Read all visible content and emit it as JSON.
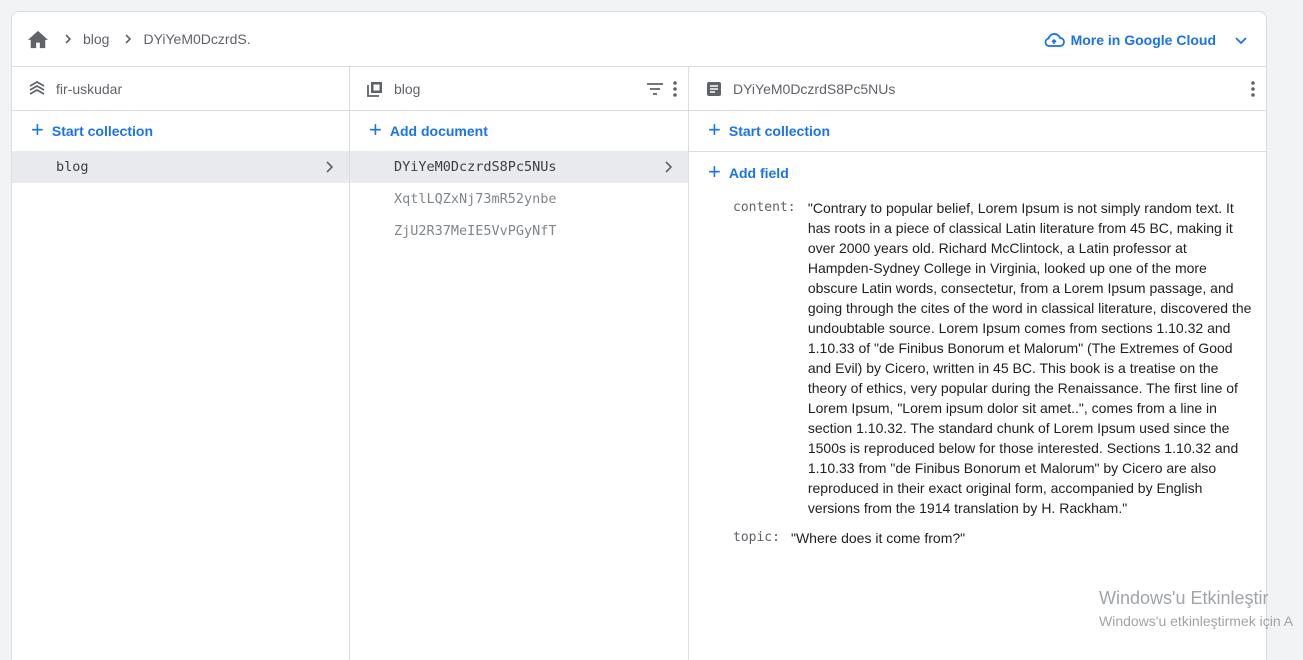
{
  "breadcrumb": {
    "items": [
      "blog",
      "DYiYeM0DczrdS."
    ]
  },
  "gcloud": {
    "label": "More in Google Cloud"
  },
  "panel1": {
    "title": "fir-uskudar",
    "action": "Start collection",
    "items": [
      "blog"
    ]
  },
  "panel2": {
    "title": "blog",
    "action": "Add document",
    "items": [
      "DYiYeM0DczrdS8Pc5NUs",
      "XqtlLQZxNj73mR52ynbe",
      "ZjU2R37MeIE5VvPGyNfT"
    ]
  },
  "panel3": {
    "title": "DYiYeM0DczrdS8Pc5NUs",
    "action": "Start collection",
    "add_field": "Add field",
    "fields": [
      {
        "key": "content:",
        "value": "\"Contrary to popular belief, Lorem Ipsum is not simply random text. It has roots in a piece of classical Latin literature from 45 BC, making it over 2000 years old. Richard McClintock, a Latin professor at Hampden-Sydney College in Virginia, looked up one of the more obscure Latin words, consectetur, from a Lorem Ipsum passage, and going through the cites of the word in classical literature, discovered the undoubtable source. Lorem Ipsum comes from sections 1.10.32 and 1.10.33 of \"de Finibus Bonorum et Malorum\" (The Extremes of Good and Evil) by Cicero, written in 45 BC. This book is a treatise on the theory of ethics, very popular during the Renaissance. The first line of Lorem Ipsum, \"Lorem ipsum dolor sit amet..\", comes from a line in section 1.10.32. The standard chunk of Lorem Ipsum used since the 1500s is reproduced below for those interested. Sections 1.10.32 and 1.10.33 from \"de Finibus Bonorum et Malorum\" by Cicero are also reproduced in their exact original form, accompanied by English versions from the 1914 translation by H. Rackham.\""
      },
      {
        "key": "topic:",
        "value": "\"Where does it come from?\""
      }
    ]
  },
  "watermark": {
    "line1": "Windows'u Etkinleştir",
    "line2": "Windows'u etkinleştirmek için A"
  },
  "colors": {
    "accent": "#1a73e8",
    "selected_bg": "#e8eaed",
    "border": "#dadce0"
  }
}
